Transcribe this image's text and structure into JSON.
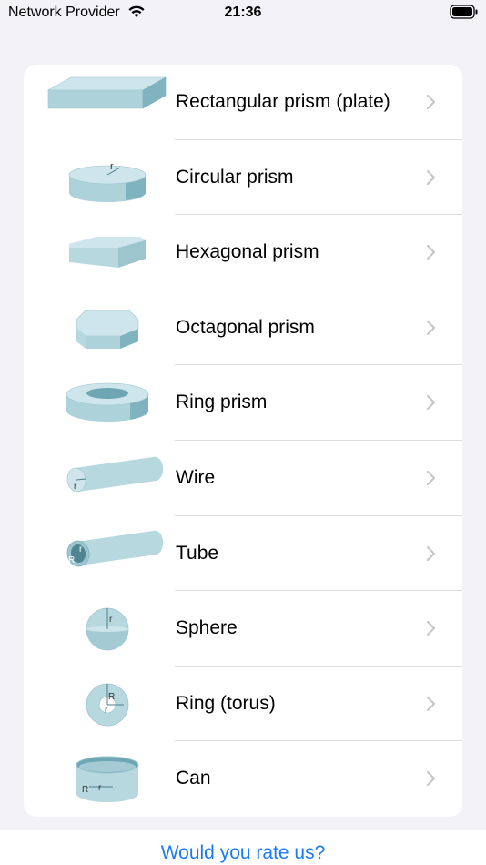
{
  "status_bar": {
    "carrier": "Network Provider",
    "time": "21:36",
    "wifi_icon": "wifi-icon",
    "battery_icon": "battery-icon"
  },
  "colors": {
    "shape_fill": "#b8d8e0",
    "shape_dark": "#7fb3bf",
    "link": "#1a7cf5",
    "chevron": "#c4c4c7"
  },
  "shapes": [
    {
      "label": "Rectangular prism (plate)",
      "icon": "rectangular-prism-icon"
    },
    {
      "label": "Circular prism",
      "icon": "circular-prism-icon",
      "mark": "r"
    },
    {
      "label": "Hexagonal prism",
      "icon": "hexagonal-prism-icon"
    },
    {
      "label": "Octagonal prism",
      "icon": "octagonal-prism-icon"
    },
    {
      "label": "Ring prism",
      "icon": "ring-prism-icon"
    },
    {
      "label": "Wire",
      "icon": "wire-icon",
      "mark": "r"
    },
    {
      "label": "Tube",
      "icon": "tube-icon",
      "marks": [
        "R",
        "r"
      ]
    },
    {
      "label": "Sphere",
      "icon": "sphere-icon",
      "mark": "r"
    },
    {
      "label": "Ring (torus)",
      "icon": "torus-icon",
      "marks": [
        "R",
        "r"
      ]
    },
    {
      "label": "Can",
      "icon": "can-icon",
      "marks": [
        "R",
        "r"
      ]
    }
  ],
  "footer": {
    "rate_label": "Would you rate us?"
  }
}
